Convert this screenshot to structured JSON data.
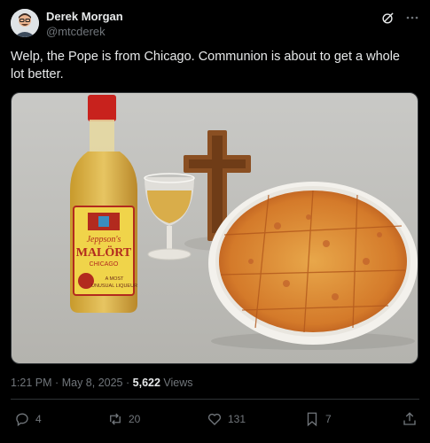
{
  "author": {
    "name": "Derek Morgan",
    "handle": "@mtcderek"
  },
  "tweet": {
    "text": "Welp, the Pope is from Chicago. Communion is about to get a whole lot better."
  },
  "media": {
    "bottle_label_line1": "Jeppson's",
    "bottle_label_line2": "MALÖRT",
    "bottle_label_line3": "CHICAGO",
    "bottle_label_line4": "A MOST",
    "bottle_label_line5": "UNUSUAL LIQUEUR"
  },
  "meta": {
    "time": "1:21 PM",
    "sep1": "·",
    "date": "May 8, 2025",
    "sep2": "·",
    "views_count": "5,622",
    "views_label": "Views"
  },
  "actions": {
    "replies": "4",
    "reposts": "20",
    "likes": "131",
    "bookmarks": "7"
  },
  "colors": {
    "background": "#000000",
    "text": "#e7e9ea",
    "muted": "#71767b"
  }
}
